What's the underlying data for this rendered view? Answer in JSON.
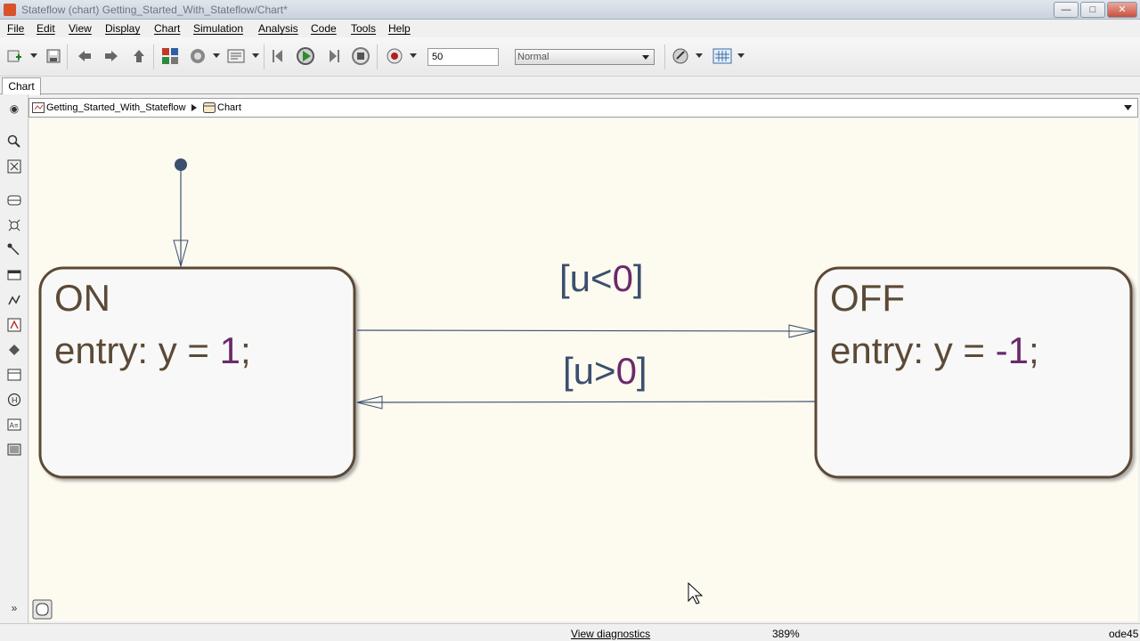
{
  "window": {
    "title": "Stateflow (chart) Getting_Started_With_Stateflow/Chart*",
    "buttons": [
      "—",
      "□",
      "✕"
    ]
  },
  "menubar": [
    "File",
    "Edit",
    "View",
    "Display",
    "Chart",
    "Simulation",
    "Analysis",
    "Code",
    "Tools",
    "Help"
  ],
  "toolbar": {
    "stop_time": "50",
    "simulation_mode": "Normal",
    "icons": [
      "new-model-icon",
      "save-icon",
      "back-icon",
      "forward-icon",
      "up-icon",
      "library-browser-icon",
      "model-config-icon",
      "model-explorer-icon",
      "step-back-icon",
      "run-icon",
      "step-forward-icon",
      "stop-icon",
      "record-icon",
      "build-icon",
      "data-inspector-icon"
    ]
  },
  "tabs": [
    "Chart"
  ],
  "breadcrumb": {
    "model": "Getting_Started_With_Stateflow",
    "chart": "Chart"
  },
  "diagram": {
    "states": [
      {
        "name": "ON",
        "action_prefix": "entry: y = ",
        "action_value": "1",
        "action_suffix": ";"
      },
      {
        "name": "OFF",
        "action_prefix": "entry: y = ",
        "action_value": "-1",
        "action_suffix": ";"
      }
    ],
    "transitions": [
      {
        "open": "[u<",
        "value": "0",
        "close": "]"
      },
      {
        "open": "[u>",
        "value": "0",
        "close": "]"
      }
    ],
    "colors": {
      "state_text": "#5b4a36",
      "state_border": "#5b4a36",
      "state_fill": "#f8f8f8",
      "transition_bracket": "#3b4f6e",
      "number": "#6b2a6b",
      "canvas_bg": "#fdfaf0",
      "default_transition_dot": "#3b4f6e"
    }
  },
  "statusbar": {
    "diagnostics": "View diagnostics",
    "zoom": "389%",
    "solver": "ode45"
  }
}
